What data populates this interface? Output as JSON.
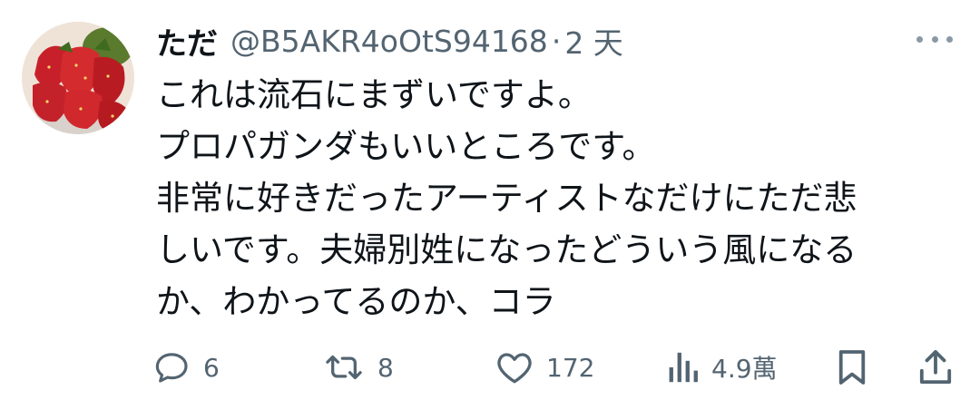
{
  "tweet": {
    "author": {
      "display_name": "ただ",
      "handle": "@B5AKR4oOtS94168",
      "avatar": "strawberries-photo"
    },
    "separator": "·",
    "time": "2 天",
    "more_icon": "more-horizontal-icon",
    "text_lines": [
      "これは流石にまずいですよ。",
      "プロパガンダもいいところです。",
      "非常に好きだったアーティストなだけにただ悲",
      "しいです。夫婦別姓になったどういう風になる",
      "か、わかってるのか、コラ"
    ],
    "actions": {
      "reply": {
        "icon": "reply-bubble-icon",
        "count": "6"
      },
      "retweet": {
        "icon": "retweet-icon",
        "count": "8"
      },
      "like": {
        "icon": "heart-icon",
        "count": "172"
      },
      "views": {
        "icon": "views-chart-icon",
        "count": "4.9萬"
      },
      "bookmark": {
        "icon": "bookmark-icon"
      },
      "share": {
        "icon": "share-upload-icon"
      }
    },
    "colors": {
      "text": "#0f1419",
      "secondary": "#536471"
    }
  }
}
